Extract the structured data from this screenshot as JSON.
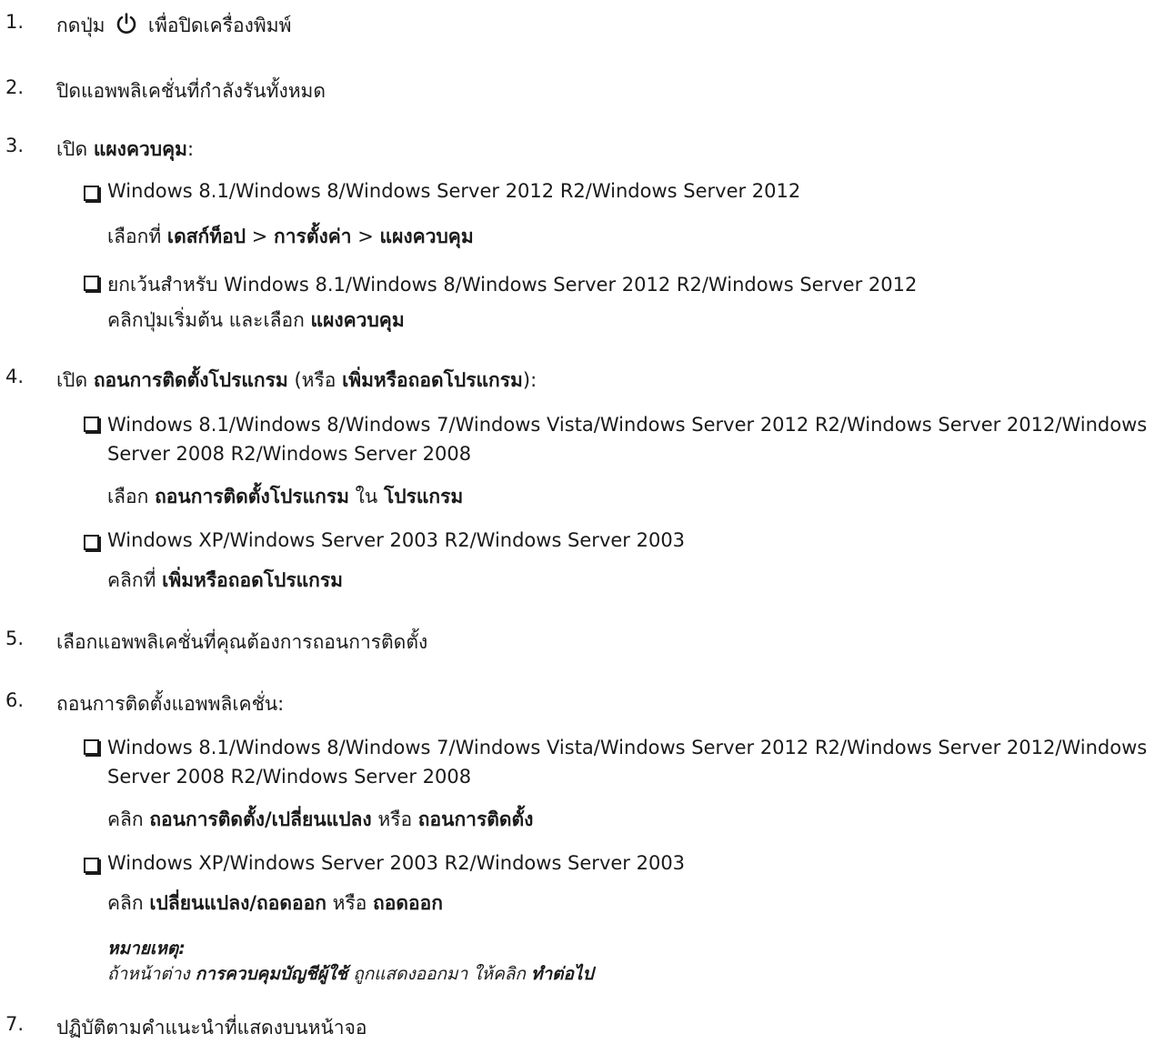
{
  "steps": [
    {
      "num": "1.",
      "pre": "กดปุ่ม",
      "icon": "power-icon",
      "post": "เพื่อปิดเครื่องพิมพ์"
    },
    {
      "num": "2.",
      "text": "ปิดแอพพลิเคชั่นที่กำลังรันทั้งหมด"
    },
    {
      "num": "3.",
      "pre": "เปิด",
      "bold": "แผงควบคุม",
      "post": ":",
      "items": [
        {
          "os": "Windows 8.1/Windows 8/Windows Server 2012 R2/Windows Server 2012",
          "act_pre": "เลือกที่",
          "act_b1": "เดสก์ท็อป",
          "sep1": ">",
          "act_b2": "การตั้งค่า",
          "sep2": ">",
          "act_b3": "แผงควบคุม"
        },
        {
          "os": "ยกเว้นสำหรับ Windows 8.1/Windows 8/Windows Server 2012 R2/Windows Server 2012",
          "act_pre": "คลิกปุ่มเริ่มต้น และเลือก",
          "act_b1": "แผงควบคุม"
        }
      ]
    },
    {
      "num": "4.",
      "pre": "เปิด",
      "bold": "ถอนการติดตั้งโปรแกรม",
      "mid": "(หรือ",
      "bold2": "เพิ่มหรือถอดโปรแกรม",
      "post": "):",
      "items": [
        {
          "os": "Windows 8.1/Windows 8/Windows 7/Windows Vista/Windows Server 2012 R2/Windows Server 2012/Windows Server 2008 R2/Windows Server 2008",
          "act_pre": "เลือก",
          "act_b1": "ถอนการติดตั้งโปรแกรม",
          "act_mid": "ใน",
          "act_b2": "โปรแกรม"
        },
        {
          "os": "Windows XP/Windows Server 2003 R2/Windows Server 2003",
          "act_pre": "คลิกที่",
          "act_b1": "เพิ่มหรือถอดโปรแกรม"
        }
      ]
    },
    {
      "num": "5.",
      "text": "เลือกแอพพลิเคชั่นที่คุณต้องการถอนการติดตั้ง"
    },
    {
      "num": "6.",
      "text": "ถอนการติดตั้งแอพพลิเคชั่น:",
      "items": [
        {
          "os": "Windows 8.1/Windows 8/Windows 7/Windows Vista/Windows Server 2012 R2/Windows Server 2012/Windows Server 2008 R2/Windows Server 2008",
          "act_pre": "คลิก",
          "act_b1": "ถอนการติดตั้ง/เปลี่ยนแปลง",
          "act_mid": "หรือ",
          "act_b2": "ถอนการติดตั้ง"
        },
        {
          "os": "Windows XP/Windows Server 2003 R2/Windows Server 2003",
          "act_pre": "คลิก",
          "act_b1": "เปลี่ยนแปลง/ถอดออก",
          "act_mid": "หรือ",
          "act_b2": "ถอดออก"
        }
      ],
      "note": {
        "title": "หมายเหตุ:",
        "pre": "ถ้าหน้าต่าง",
        "b1": "การควบคุมบัญชีผู้ใช้",
        "mid": "ถูกแสดงออกมา ให้คลิก",
        "b2": "ทำต่อไป"
      }
    },
    {
      "num": "7.",
      "text": "ปฏิบัติตามคำแนะนำที่แสดงบนหน้าจอ"
    }
  ]
}
